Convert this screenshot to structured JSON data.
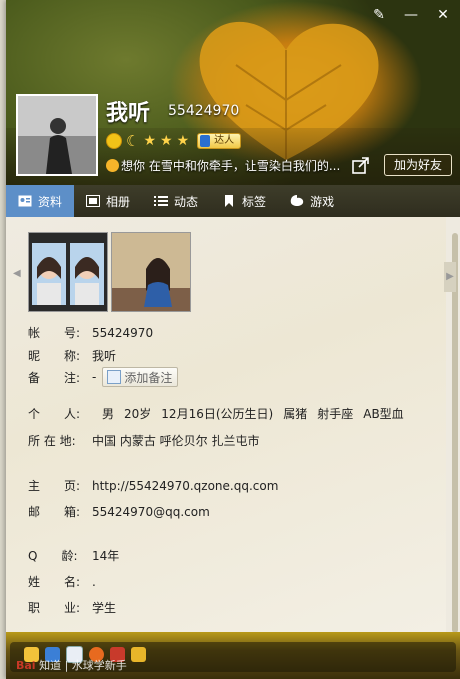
{
  "window": {
    "tools": [
      "skin-icon",
      "minimize-icon",
      "close-icon"
    ]
  },
  "profile": {
    "nickname": "我听",
    "qq": "55424970",
    "badge": "达人",
    "signature": "想你 在雪中和你牵手，让雪染白我们的...",
    "add_friend": "加为好友"
  },
  "tabs": [
    {
      "label": "资料",
      "icon": "profile-card-icon",
      "active": true
    },
    {
      "label": "相册",
      "icon": "album-icon",
      "active": false
    },
    {
      "label": "动态",
      "icon": "feed-icon",
      "active": false
    },
    {
      "label": "标签",
      "icon": "tag-icon",
      "active": false
    },
    {
      "label": "游戏",
      "icon": "game-icon",
      "active": false
    }
  ],
  "info": {
    "account": {
      "label": "帐　　号:",
      "value": "55424970"
    },
    "nick": {
      "label": "昵　　称:",
      "value": "我听"
    },
    "remark": {
      "label": "备　　注:",
      "value": "-",
      "button": "添加备注"
    },
    "personal": {
      "label": "个　　人:",
      "gender": "男",
      "age": "20岁",
      "birthday": "12月16日(公历生日)",
      "zodiac": "属猪",
      "constellation": "射手座",
      "blood": "AB型血"
    },
    "location": {
      "label": "所 在 地:",
      "value": "中国 内蒙古 呼伦贝尔 扎兰屯市"
    },
    "homepage": {
      "label": "主　　页:",
      "value": "http://55424970.qzone.qq.com"
    },
    "email": {
      "label": "邮　　箱:",
      "value": "55424970@qq.com"
    },
    "qage": {
      "label": "Q　　龄:",
      "value": "14年"
    },
    "realname": {
      "label": "姓　　名:",
      "value": "."
    },
    "job": {
      "label": "职　　业:",
      "value": "学生"
    }
  },
  "watermark": {
    "brand": "Bai",
    "text": "知道 | 水球学新手"
  },
  "colors": {
    "tab_active": "#5d8fc8",
    "tab_bar": "#2f2d1e"
  }
}
